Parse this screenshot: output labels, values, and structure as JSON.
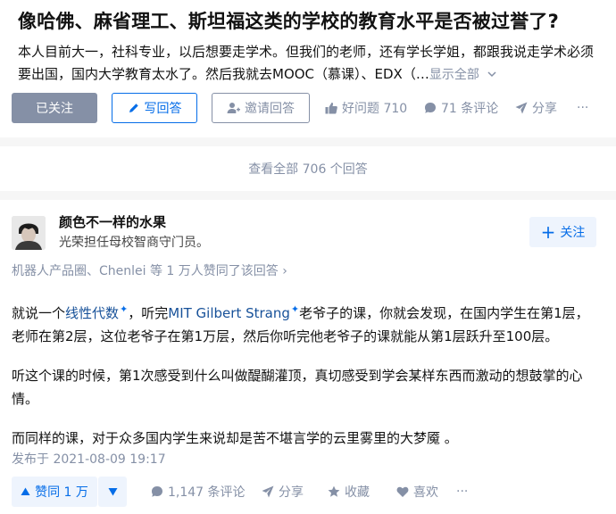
{
  "question": {
    "title": "像哈佛、麻省理工、斯坦福这类的学校的教育水平是否被过誉了?",
    "description": "本人目前大一，社科专业，以后想要走学术。但我们的老师，还有学长学姐，都跟我说走学术必须要出国，国内大学教育太水了。然后我就去MOOC（慕课）、EDX（…",
    "show_all": "显示全部",
    "followed_label": "已关注",
    "write_answer_label": "写回答",
    "invite_label": "邀请回答",
    "good_question": "好问题 710",
    "comments": "71 条评论",
    "share": "分享",
    "more": "···"
  },
  "view_all": "查看全部 706 个回答",
  "answer": {
    "author_name": "颜色不一样的水果",
    "author_bio": "光荣担任母校智商守门员。",
    "follow_label": "关注",
    "follow_plus": "+",
    "upvoters": "机器人产品圈、Chenlei 等 1 万人赞同了该回答 ›",
    "p1_a": "就说一个",
    "p1_link1": "线性代数",
    "p1_b": "，听完",
    "p1_link2": "MIT Gilbert Strang",
    "p1_c": "老爷子的课，你就会发现，在国内学生在第1层，老师在第2层，这位老爷子在第1万层，然后你听完他老爷子的课就能从第1层跃升至100层。",
    "spark": "✦",
    "p2": "听这个课的时候，第1次感受到什么叫做醍醐灌顶，真切感受到学会某样东西而激动的想鼓掌的心情。",
    "p3": "而同样的课，对于众多国内学生来说却是苦不堪言学的云里雾里的大梦魇 。",
    "published": "发布于 2021-08-09 19:17",
    "vote_up": "赞同 1 万",
    "comments": "1,147 条评论",
    "share": "分享",
    "collect": "收藏",
    "like": "喜欢",
    "more": "···"
  },
  "colors": {
    "brand": "#056de8",
    "gray": "#8590a6",
    "light_blue_bg": "#eef4fd"
  }
}
